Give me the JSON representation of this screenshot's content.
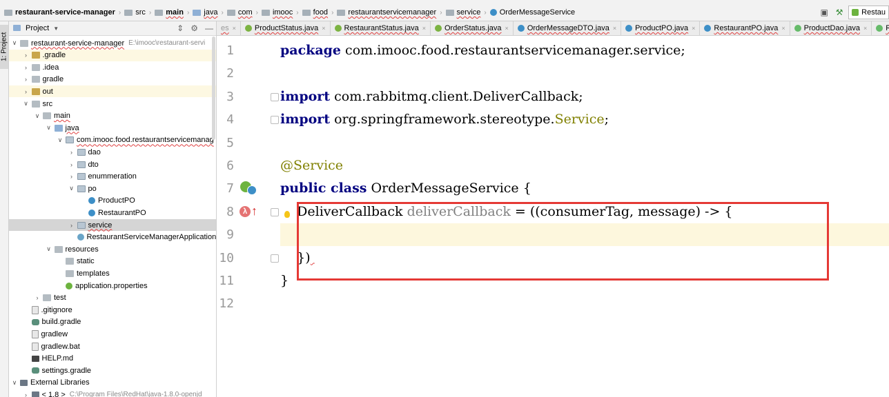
{
  "breadcrumbs": [
    {
      "label": "restaurant-service-manager",
      "bold": true,
      "icon": "module"
    },
    {
      "label": "src",
      "icon": "folder"
    },
    {
      "label": "main",
      "bold": true,
      "icon": "folder"
    },
    {
      "label": "java",
      "icon": "source-folder"
    },
    {
      "label": "com",
      "icon": "package"
    },
    {
      "label": "imooc",
      "icon": "package"
    },
    {
      "label": "food",
      "icon": "package"
    },
    {
      "label": "restaurantservicemanager",
      "icon": "package"
    },
    {
      "label": "service",
      "icon": "package"
    },
    {
      "label": "OrderMessageService",
      "icon": "class"
    }
  ],
  "run_config": {
    "label": "Restau"
  },
  "sidebar": {
    "tab_label": "1: Project"
  },
  "project_panel": {
    "title": "Project"
  },
  "tree": [
    {
      "label": "restaurant-service-manager",
      "path": "E:\\imooc\\restaurant-servi",
      "depth": 0,
      "arrow": "down",
      "icon": "gfolder",
      "wavy": true
    },
    {
      "label": ".gradle",
      "depth": 1,
      "arrow": "right",
      "icon": "folder",
      "hl": true
    },
    {
      "label": ".idea",
      "depth": 1,
      "arrow": "right",
      "icon": "gfolder"
    },
    {
      "label": "gradle",
      "depth": 1,
      "arrow": "right",
      "icon": "gfolder"
    },
    {
      "label": "out",
      "depth": 1,
      "arrow": "right",
      "icon": "folder",
      "hl": true
    },
    {
      "label": "src",
      "depth": 1,
      "arrow": "down",
      "icon": "gfolder"
    },
    {
      "label": "main",
      "depth": 2,
      "arrow": "down",
      "icon": "gfolder",
      "wavy": true
    },
    {
      "label": "java",
      "depth": 3,
      "arrow": "down",
      "icon": "bfolder",
      "wavy": true
    },
    {
      "label": "com.imooc.food.restaurantservicemanag",
      "depth": 4,
      "arrow": "down",
      "icon": "pkg",
      "wavy": true
    },
    {
      "label": "dao",
      "depth": 5,
      "arrow": "right",
      "icon": "pkg"
    },
    {
      "label": "dto",
      "depth": 5,
      "arrow": "right",
      "icon": "pkg"
    },
    {
      "label": "enummeration",
      "depth": 5,
      "arrow": "right",
      "icon": "pkg"
    },
    {
      "label": "po",
      "depth": 5,
      "arrow": "down",
      "icon": "pkg"
    },
    {
      "label": "ProductPO",
      "depth": 6,
      "arrow": "none",
      "icon": "cls"
    },
    {
      "label": "RestaurantPO",
      "depth": 6,
      "arrow": "none",
      "icon": "cls"
    },
    {
      "label": "service",
      "depth": 5,
      "arrow": "right",
      "icon": "pkg",
      "sel": true,
      "wavy": true
    },
    {
      "label": "RestaurantServiceManagerApplication",
      "depth": 5,
      "arrow": "none",
      "icon": "app"
    },
    {
      "label": "resources",
      "depth": 3,
      "arrow": "down",
      "icon": "gfolder"
    },
    {
      "label": "static",
      "depth": 4,
      "arrow": "none",
      "icon": "gfolder"
    },
    {
      "label": "templates",
      "depth": 4,
      "arrow": "none",
      "icon": "gfolder"
    },
    {
      "label": "application.properties",
      "depth": 4,
      "arrow": "none",
      "icon": "spring"
    },
    {
      "label": "test",
      "depth": 2,
      "arrow": "right",
      "icon": "gfolder"
    },
    {
      "label": ".gitignore",
      "depth": 1,
      "arrow": "none",
      "icon": "file"
    },
    {
      "label": "build.gradle",
      "depth": 1,
      "arrow": "none",
      "icon": "gradle"
    },
    {
      "label": "gradlew",
      "depth": 1,
      "arrow": "none",
      "icon": "file"
    },
    {
      "label": "gradlew.bat",
      "depth": 1,
      "arrow": "none",
      "icon": "file"
    },
    {
      "label": "HELP.md",
      "depth": 1,
      "arrow": "none",
      "icon": "md"
    },
    {
      "label": "settings.gradle",
      "depth": 1,
      "arrow": "none",
      "icon": "gradle"
    },
    {
      "label": "External Libraries",
      "depth": 0,
      "arrow": "down",
      "icon": "lib"
    },
    {
      "label": "< 1.8 >",
      "path": "C:\\Program Files\\RedHat\\java-1.8.0-openjd",
      "depth": 1,
      "arrow": "right",
      "icon": "lib"
    }
  ],
  "editor_tabs": [
    {
      "label": "es",
      "icon": "none"
    },
    {
      "label": "ProductStatus.java",
      "icon": "enum"
    },
    {
      "label": "RestaurantStatus.java",
      "icon": "enum"
    },
    {
      "label": "OrderStatus.java",
      "icon": "enum"
    },
    {
      "label": "OrderMessageDTO.java",
      "icon": "class"
    },
    {
      "label": "ProductPO.java",
      "icon": "class"
    },
    {
      "label": "RestaurantPO.java",
      "icon": "class"
    },
    {
      "label": "ProductDao.java",
      "icon": "iface"
    },
    {
      "label": "Re",
      "icon": "iface"
    }
  ],
  "code_lines": [
    {
      "n": "1",
      "parts": [
        [
          "kw",
          "package"
        ],
        [
          "t",
          " com.imooc.food.restaurantservicemanager.service;"
        ]
      ]
    },
    {
      "n": "2",
      "parts": []
    },
    {
      "n": "3",
      "parts": [
        [
          "kw",
          "import"
        ],
        [
          "t",
          " com.rabbitmq.client.DeliverCallback;"
        ]
      ]
    },
    {
      "n": "4",
      "parts": [
        [
          "kw",
          "import"
        ],
        [
          "t",
          " org.springframework.stereotype."
        ],
        [
          "iface",
          "Service"
        ],
        [
          "t",
          ";"
        ]
      ]
    },
    {
      "n": "5",
      "parts": []
    },
    {
      "n": "6",
      "parts": [
        [
          "ann",
          "@Service"
        ]
      ]
    },
    {
      "n": "7",
      "parts": [
        [
          "kw",
          "public class"
        ],
        [
          "t",
          " OrderMessageService {"
        ]
      ]
    },
    {
      "n": "8",
      "parts": [
        [
          "t",
          "    DeliverCallback "
        ],
        [
          "gray",
          "deliverCallback"
        ],
        [
          "t",
          " = ((consumerTag, message) -> {"
        ]
      ]
    },
    {
      "n": "9",
      "parts": [],
      "current": true
    },
    {
      "n": "10",
      "parts": [
        [
          "t",
          "    })"
        ],
        [
          "sq",
          " "
        ]
      ]
    },
    {
      "n": "11",
      "parts": [
        [
          "t",
          "}"
        ]
      ]
    },
    {
      "n": "12",
      "parts": []
    }
  ]
}
